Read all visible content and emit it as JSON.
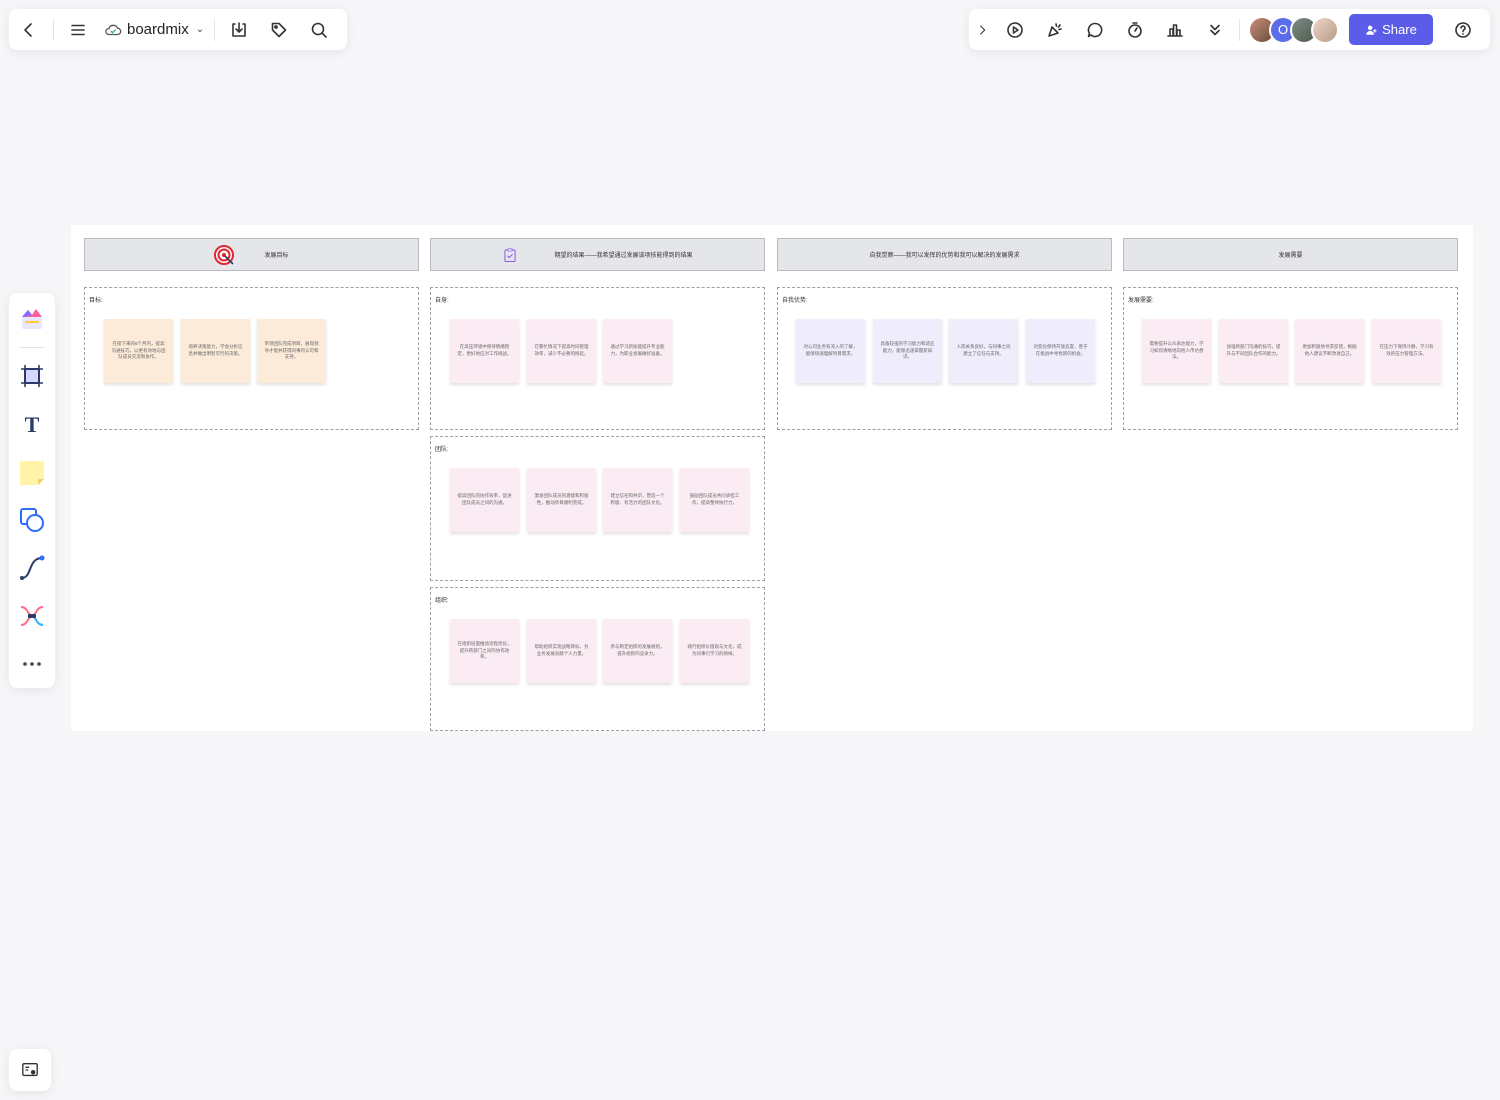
{
  "app": {
    "name": "boardmix"
  },
  "topbar": {
    "share_label": "Share",
    "avatar_o": "O"
  },
  "colors": {
    "accent": "#5b5ce8",
    "note_orange": "#fdebd9",
    "note_pink": "#fbecf4",
    "note_lavender": "#efedfc",
    "header_bg": "#e5e6e9"
  },
  "board": {
    "headers": [
      {
        "title": "发展目标",
        "icon": "target-icon"
      },
      {
        "title": "期望的结果——我希望通过发展该项技能得到的结果",
        "icon": "checklist-icon"
      },
      {
        "title": "自我觉察——我可以发挥的优势和我可以解决的发展需求",
        "icon": ""
      },
      {
        "title": "发展需要",
        "icon": ""
      }
    ],
    "sections": [
      {
        "label": "目标:",
        "notes": [
          "在接下来的6个月内，提高沟通技巧，以更有效地与团队成员交流和协作。",
          "培养决策能力，学会分析信息并做出明智可行的决策。",
          "带领团队完成项目，展现领导才能并获得同事的认可和支持。"
        ]
      },
      {
        "label": "自身:",
        "notes": [
          "在高压环境中保持情绪稳定，更好地应对工作挑战。",
          "在繁忙情况下提高时间管理效率，减少不必要的拖延。",
          "通过学习新技能提升专业能力，为职业发展做好准备。"
        ]
      },
      {
        "label": "团队:",
        "notes": [
          "提高团队的协作效率，促进团队成员之间的沟通。",
          "激发团队成员的潜能和积极性，推动项目顺利完成。",
          "建立信任和共识，营造一个积极、有活力的团队文化。",
          "鼓励团队成员共同承担工作，提高整体执行力。"
        ]
      },
      {
        "label": "组织:",
        "notes": [
          "在组织层面推动流程优化，提升跨部门之间的协作效率。",
          "帮助组织实现战略目标，为业务发展贡献个人力量。",
          "参与制定组织的发展规划，提升组织的竞争力。",
          "践行组织价值观与文化，成为同事们学习的榜样。"
        ]
      },
      {
        "label": "自我优势:",
        "notes": [
          "对公司业务有深入的了解，能够快速理解项目需求。",
          "具备较强的学习能力和适应能力，能够迅速掌握新知识。",
          "人际关系良好，与同事之间建立了信任与支持。",
          "对变化保持开放态度，善于在挑战中寻找新的机会。"
        ]
      },
      {
        "label": "发展需要:",
        "notes": [
          "需要提升公众表达能力，学习如何清晰地向他人传达想法。",
          "加强跨部门沟通的技巧，提升与不同团队合作的能力。",
          "更加积极地寻求反馈，根据他人建议不断改进自己。",
          "在压力下保持冷静，学习有效的压力管理方法。"
        ]
      }
    ]
  }
}
